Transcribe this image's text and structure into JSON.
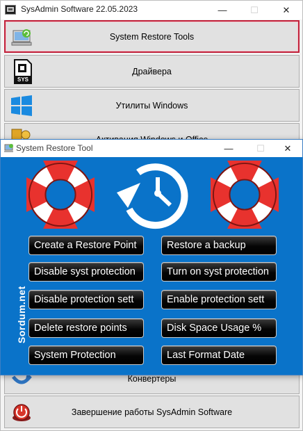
{
  "main_window": {
    "title": "SysAdmin Software 22.05.2023",
    "controls": {
      "minimize": "—",
      "maximize": "☐",
      "close": "✕"
    },
    "menu": [
      {
        "label": "System Restore Tools",
        "icon": "computer-restore-icon"
      },
      {
        "label": "Драйвера",
        "icon": "sys-file-icon"
      },
      {
        "label": "Утилиты Windows",
        "icon": "windows-logo-icon"
      },
      {
        "label": "Активация Windows и Office",
        "icon": "activation-key-icon"
      },
      {
        "label": "Конвертеры",
        "icon": "convert-arrow-icon"
      },
      {
        "label": "Завершение работы SysAdmin Software",
        "icon": "power-button-icon"
      }
    ]
  },
  "tool_window": {
    "title": "System Restore Tool",
    "controls": {
      "minimize": "—",
      "maximize": "☐",
      "close": "✕"
    },
    "side_label": "Sordum.net",
    "buttons_left": [
      "Create a Restore Point",
      "Disable syst protection",
      "Disable protection sett",
      "Delete restore points",
      "System Protection"
    ],
    "buttons_right": [
      "Restore a backup",
      "Turn on syst protection",
      "Enable protection sett",
      "Disk Space Usage %",
      "Last Format Date"
    ]
  },
  "colors": {
    "tool_background": "#0a73c9",
    "active_border": "#c0223b",
    "lifebuoy_red": "#e8322e"
  }
}
